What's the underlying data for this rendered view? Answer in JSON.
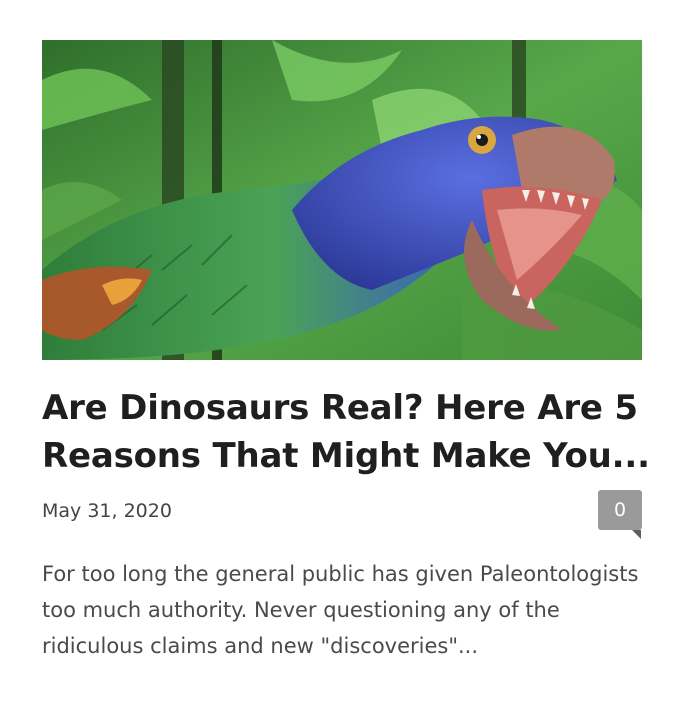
{
  "post": {
    "image": {
      "alt_icon": "feathered-dinosaur-illustration"
    },
    "title": "Are Dinosaurs Real? Here Are 5 Reasons That Might Make You...",
    "date": "May 31, 2020",
    "comment_count": "0",
    "excerpt": "For too long the general public has given Paleontologists too much authority. Never questioning any of the ridiculous claims and new \"discoveries\"..."
  },
  "colors": {
    "title": "#1f1f1f",
    "date": "#444444",
    "excerpt": "#4a4a4a",
    "badge": "#9a9a9a",
    "jungle": "#3f8f3a",
    "dino_blue": "#3f4fb8",
    "dino_green": "#3e9a4a"
  }
}
